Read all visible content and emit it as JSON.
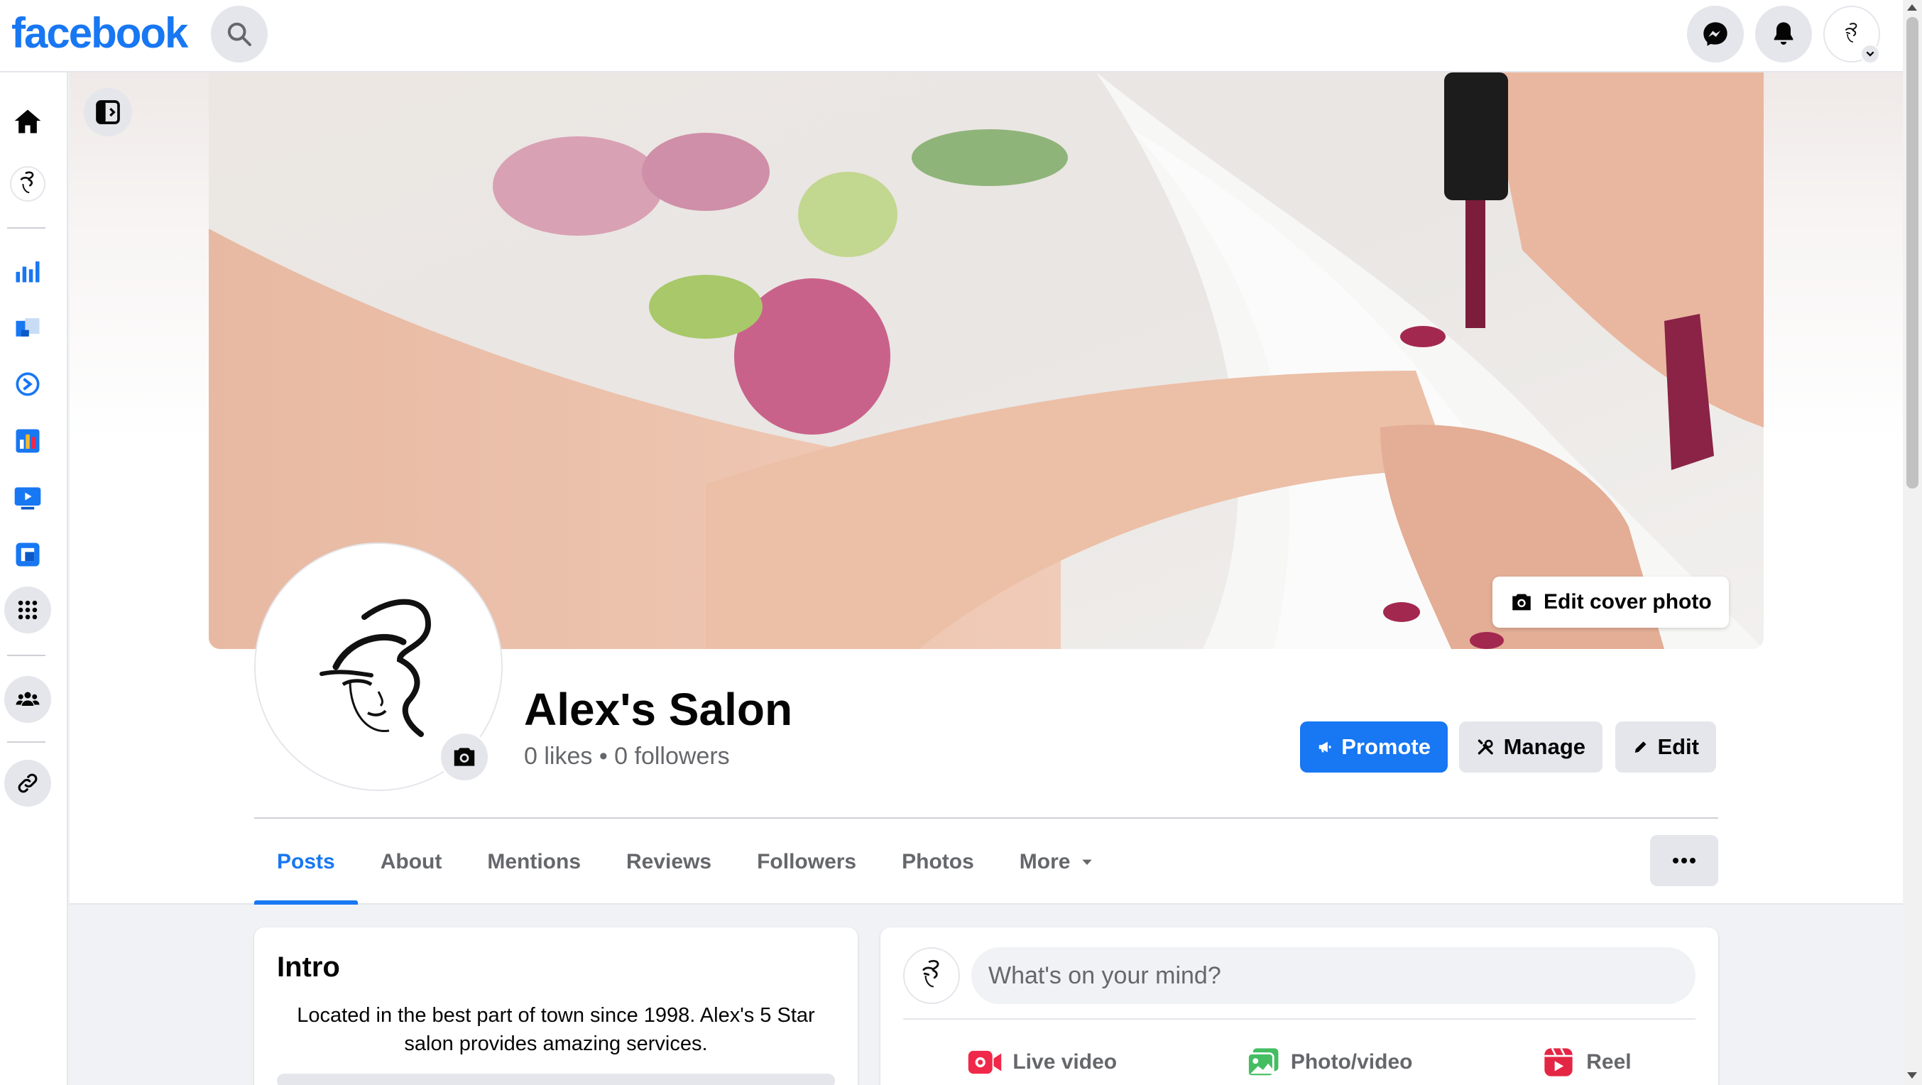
{
  "header": {
    "logo_text": "facebook",
    "search_icon": "search-icon",
    "messenger_icon": "messenger-icon",
    "notifications_icon": "bell-icon",
    "account_icon": "avatar"
  },
  "rail": {
    "items": [
      "home-icon",
      "page-avatar",
      "insights-icon",
      "ads-icon",
      "meta-business-icon",
      "analytics-icon",
      "video-icon",
      "content-icon",
      "apps-grid-icon",
      "groups-icon",
      "link-icon"
    ]
  },
  "cover": {
    "edit_label": "Edit cover photo"
  },
  "page": {
    "name": "Alex's Salon",
    "stats": "0 likes • 0 followers"
  },
  "actions": {
    "promote": "Promote",
    "manage": "Manage",
    "edit": "Edit"
  },
  "tabs": [
    {
      "label": "Posts"
    },
    {
      "label": "About"
    },
    {
      "label": "Mentions"
    },
    {
      "label": "Reviews"
    },
    {
      "label": "Followers"
    },
    {
      "label": "Photos"
    },
    {
      "label": "More"
    }
  ],
  "intro": {
    "title": "Intro",
    "bio": "Located in the best part of town since 1998. Alex's 5 Star salon provides amazing services."
  },
  "composer": {
    "placeholder": "What's on your mind?",
    "live_video": "Live video",
    "photo_video": "Photo/video",
    "reel": "Reel"
  },
  "colors": {
    "brand": "#1877f2",
    "live": "#f02849",
    "photo": "#45bd62",
    "reel": "#e42645"
  }
}
